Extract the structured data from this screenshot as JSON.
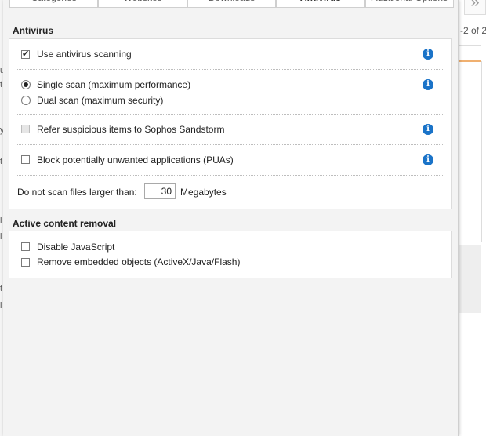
{
  "tabs": [
    {
      "label": "Categories",
      "active": false
    },
    {
      "label": "Websites",
      "active": false
    },
    {
      "label": "Downloads",
      "active": false
    },
    {
      "label": "Antivirus",
      "active": true
    },
    {
      "label": "Additional Options",
      "active": false
    }
  ],
  "background": {
    "pagination_text": "-2 of 2",
    "collapse_glyph": "»",
    "left_edge_glyphs": [
      "u",
      "t",
      "y",
      "t",
      "l",
      "l",
      "t",
      "l"
    ]
  },
  "antivirus": {
    "title": "Antivirus",
    "use_scanning": {
      "label": "Use antivirus scanning",
      "checked": true
    },
    "scan_mode": {
      "options": [
        {
          "label": "Single scan (maximum performance)",
          "selected": true
        },
        {
          "label": "Dual scan (maximum security)",
          "selected": false
        }
      ]
    },
    "sandstorm": {
      "label": "Refer suspicious items to Sophos Sandstorm",
      "checked": false,
      "disabled": true
    },
    "pua": {
      "label": "Block potentially unwanted applications (PUAs)",
      "checked": false
    },
    "max_size": {
      "label": "Do not scan files larger than:",
      "value": "30",
      "unit": "Megabytes"
    }
  },
  "active_content": {
    "title": "Active content removal",
    "disable_js": {
      "label": "Disable JavaScript",
      "checked": false
    },
    "remove_embedded": {
      "label": "Remove embedded objects (ActiveX/Java/Flash)",
      "checked": false
    }
  },
  "icons": {
    "info": "i"
  },
  "colors": {
    "info_blue": "#1a73c8",
    "accent_orange": "#f0b070"
  }
}
